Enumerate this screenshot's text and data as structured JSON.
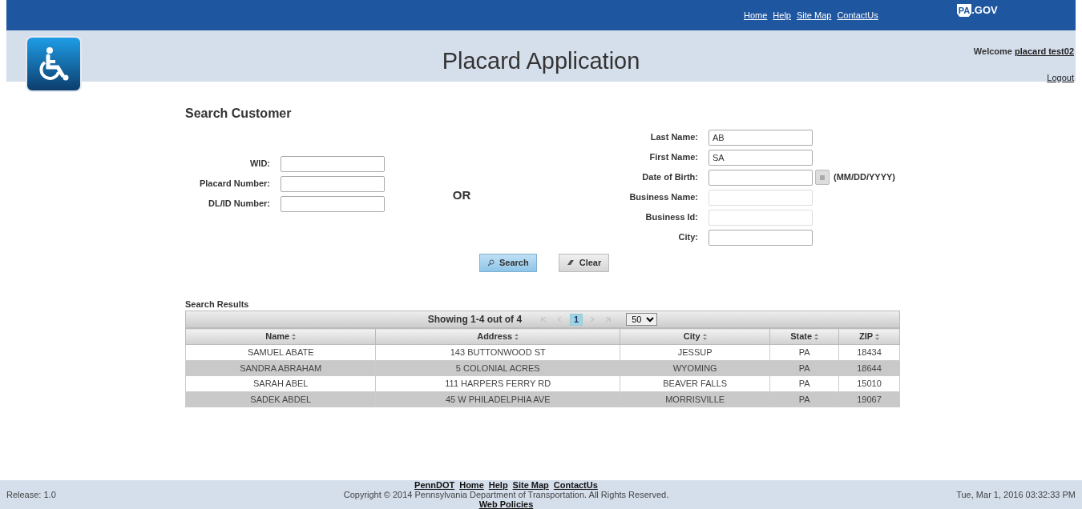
{
  "top_nav": {
    "links": [
      "Home",
      "Help",
      "Site Map",
      "ContactUs"
    ],
    "logo": {
      "badge": "PA",
      "suffix": ".GOV"
    }
  },
  "header": {
    "title": "Placard Application",
    "welcome": "Welcome",
    "user": "placard test02",
    "logout": "Logout"
  },
  "search": {
    "title": "Search Customer",
    "left_fields": [
      {
        "label": "WID:",
        "disabled": false
      },
      {
        "label": "Placard Number:",
        "disabled": false
      },
      {
        "label": "DL/ID Number:",
        "disabled": false
      }
    ],
    "separator": "OR",
    "right_fields": [
      {
        "label": "Last Name:",
        "value": "AB",
        "disabled": false
      },
      {
        "label": "First Name:",
        "value": "SA",
        "disabled": false
      },
      {
        "label": "Date of Birth:",
        "disabled": false,
        "kind": "date",
        "hint": "(MM/DD/YYYY)"
      },
      {
        "label": "Business Name:",
        "disabled": true
      },
      {
        "label": "Business Id:",
        "disabled": true
      },
      {
        "label": "City:",
        "disabled": false
      }
    ],
    "buttons": [
      {
        "label": "Search",
        "kind": "search"
      },
      {
        "label": "Clear",
        "kind": "clear"
      }
    ]
  },
  "results": {
    "title": "Search Results",
    "summary": "Showing 1-4 out of 4",
    "pager": [
      {
        "kind": "first",
        "disabled": true
      },
      {
        "kind": "prev",
        "disabled": true
      },
      {
        "kind": "page",
        "label": "1",
        "selected": true
      },
      {
        "kind": "next",
        "disabled": true
      },
      {
        "kind": "last",
        "disabled": true
      }
    ],
    "page_size": "50",
    "columns": [
      "Name",
      "Address",
      "City",
      "State",
      "ZIP"
    ],
    "rows": [
      [
        "SAMUEL ABATE",
        "143 BUTTONWOOD ST",
        "JESSUP",
        "PA",
        "18434"
      ],
      [
        "SANDRA ABRAHAM",
        "5 COLONIAL ACRES",
        "WYOMING",
        "PA",
        "18644"
      ],
      [
        "SARAH ABEL",
        "111 HARPERS FERRY RD",
        "BEAVER FALLS",
        "PA",
        "15010"
      ],
      [
        "SADEK ABDEL",
        "45 W PHILADELPHIA AVE",
        "MORRISVILLE",
        "PA",
        "19067"
      ]
    ]
  },
  "footer": {
    "release": "Release: 1.0",
    "links": [
      "PennDOT",
      "Home",
      "Help",
      "Site Map",
      "ContactUs"
    ],
    "copyright": "Copyright © 2014 Pennsylvania Department of Transportation. All Rights Reserved.",
    "policies": "Web Policies",
    "timestamp": "Tue, Mar 1, 2016 03:32:33 PM"
  }
}
